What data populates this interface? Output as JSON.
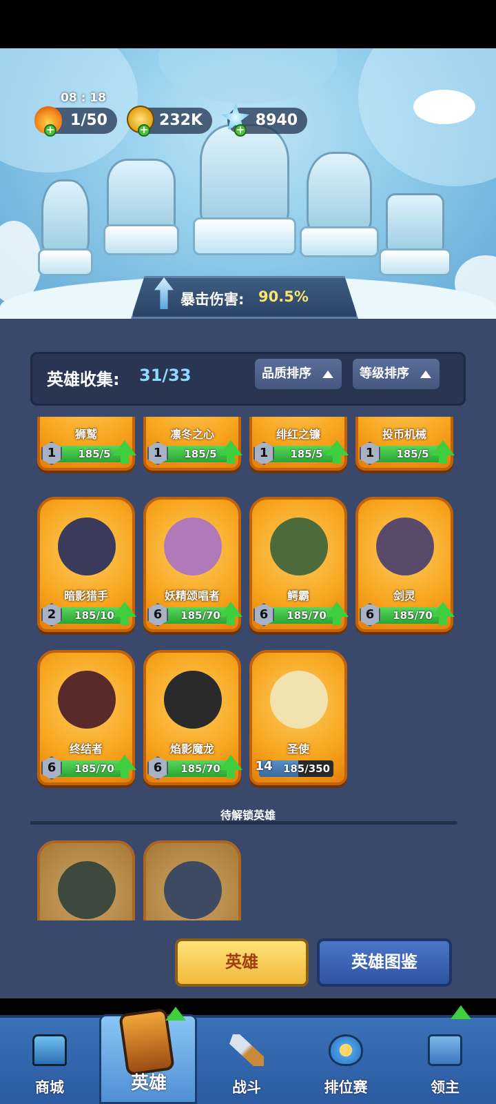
{
  "status": {
    "timer": "08 : 18"
  },
  "resources": {
    "energy": "1/50",
    "gold": "232K",
    "crystals": "8940"
  },
  "bonus": {
    "label": "暴击伤害:",
    "value": "90.5%"
  },
  "collection": {
    "label": "英雄收集:",
    "value": "31/33"
  },
  "sort": {
    "quality": "品质排序",
    "level": "等级排序"
  },
  "heroes": [
    {
      "name": "狮鹫",
      "level": "1",
      "progress": "185/5",
      "fill": 1.0,
      "upgrade": true
    },
    {
      "name": "凛冬之心",
      "level": "1",
      "progress": "185/5",
      "fill": 1.0,
      "upgrade": true
    },
    {
      "name": "绯红之镰",
      "level": "1",
      "progress": "185/5",
      "fill": 1.0,
      "upgrade": true
    },
    {
      "name": "投币机械",
      "level": "1",
      "progress": "185/5",
      "fill": 1.0,
      "upgrade": true
    },
    {
      "name": "暗影猎手",
      "level": "2",
      "progress": "185/10",
      "fill": 1.0,
      "upgrade": true
    },
    {
      "name": "妖精颂唱者",
      "level": "6",
      "progress": "185/70",
      "fill": 1.0,
      "upgrade": true
    },
    {
      "name": "鳄霸",
      "level": "6",
      "progress": "185/70",
      "fill": 1.0,
      "upgrade": true
    },
    {
      "name": "剑灵",
      "level": "6",
      "progress": "185/70",
      "fill": 1.0,
      "upgrade": true
    },
    {
      "name": "终结者",
      "level": "6",
      "progress": "185/70",
      "fill": 1.0,
      "upgrade": true
    },
    {
      "name": "焰影魔龙",
      "level": "6",
      "progress": "185/70",
      "fill": 1.0,
      "upgrade": true
    },
    {
      "name": "圣使",
      "level": "14",
      "progress": "185/350",
      "fill": 0.53,
      "upgrade": false
    }
  ],
  "locked_section": {
    "label": "待解锁英雄"
  },
  "buttons": {
    "heroes": "英雄",
    "codex": "英雄图鉴"
  },
  "nav": {
    "shop": "商城",
    "heroes": "英雄",
    "battle": "战斗",
    "ranked": "排位赛",
    "lord": "领主"
  },
  "colors": {
    "accent_gold": "#fce36d",
    "panel": "#39486b",
    "nav": "#2b5ba0"
  }
}
